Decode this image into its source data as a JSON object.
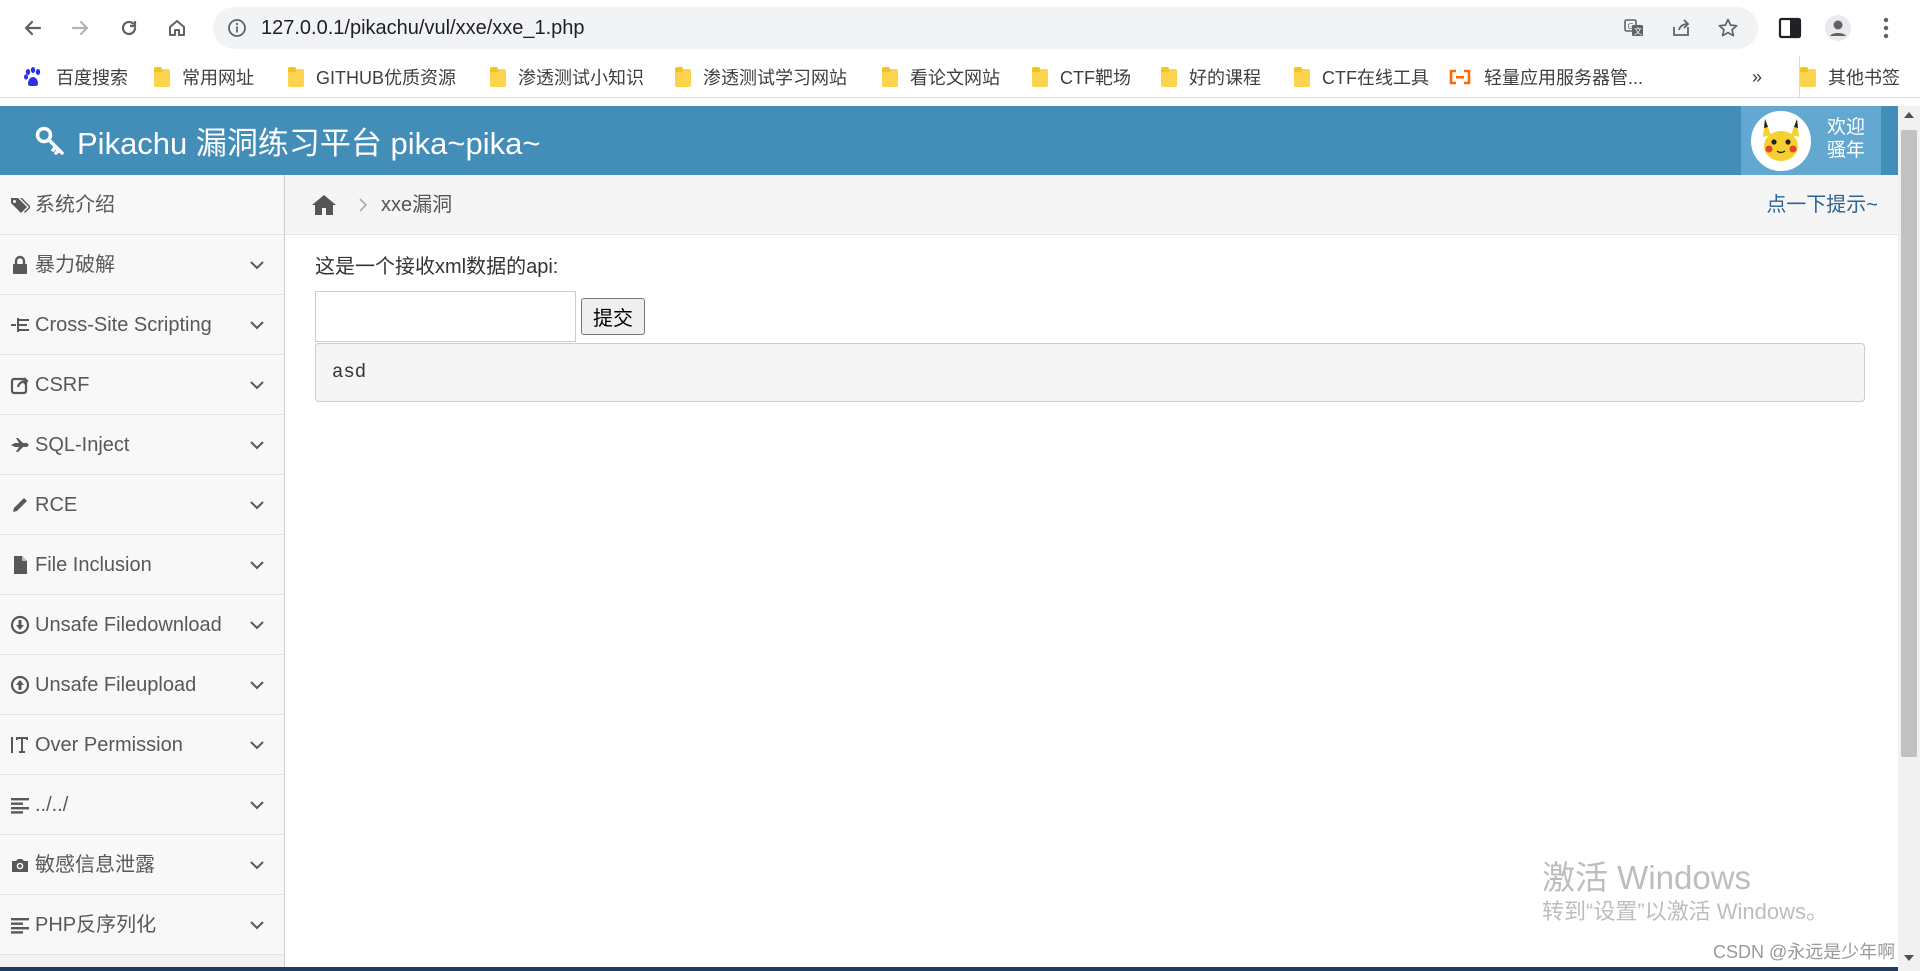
{
  "browser": {
    "url": "127.0.0.1/pikachu/vul/xxe/xxe_1.php",
    "bookmarks": [
      {
        "label": "百度搜索",
        "icon": "baidu-paw-icon"
      },
      {
        "label": "常用网址",
        "icon": "folder-icon"
      },
      {
        "label": "GITHUB优质资源",
        "icon": "folder-icon"
      },
      {
        "label": "渗透测试小知识",
        "icon": "folder-icon"
      },
      {
        "label": "渗透测试学习网站",
        "icon": "folder-icon"
      },
      {
        "label": "看论文网站",
        "icon": "folder-icon"
      },
      {
        "label": "CTF靶场",
        "icon": "folder-icon"
      },
      {
        "label": "好的课程",
        "icon": "folder-icon"
      },
      {
        "label": "CTF在线工具",
        "icon": "folder-icon"
      },
      {
        "label": "轻量应用服务器管...",
        "icon": "aliyun-icon"
      }
    ],
    "overflow": "»",
    "other_bookmarks": "其他书签"
  },
  "header": {
    "title": "Pikachu 漏洞练习平台 pika~pika~",
    "welcome_line1": "欢迎",
    "welcome_line2": "骚年",
    "color": "#438eb9"
  },
  "sidebar": {
    "items": [
      {
        "label": "系统介绍",
        "icon": "tags-icon",
        "expandable": false
      },
      {
        "label": "暴力破解",
        "icon": "lock-icon",
        "expandable": true
      },
      {
        "label": "Cross-Site Scripting",
        "icon": "indent-icon",
        "expandable": true
      },
      {
        "label": "CSRF",
        "icon": "share-icon",
        "expandable": true
      },
      {
        "label": "SQL-Inject",
        "icon": "fighter-jet-icon",
        "expandable": true
      },
      {
        "label": "RCE",
        "icon": "pencil-icon",
        "expandable": true
      },
      {
        "label": "File Inclusion",
        "icon": "file-icon",
        "expandable": true
      },
      {
        "label": "Unsafe Filedownload",
        "icon": "download-circle-icon",
        "expandable": true
      },
      {
        "label": "Unsafe Fileupload",
        "icon": "upload-circle-icon",
        "expandable": true
      },
      {
        "label": "Over Permission",
        "icon": "text-height-icon",
        "expandable": true
      },
      {
        "label": "../../",
        "icon": "align-left-icon",
        "expandable": true
      },
      {
        "label": "敏感信息泄露",
        "icon": "camera-icon",
        "expandable": true
      },
      {
        "label": "PHP反序列化",
        "icon": "align-left-icon",
        "expandable": true
      }
    ]
  },
  "breadcrumb": {
    "current": "xxe漏洞",
    "hint": "点一下提示~"
  },
  "main": {
    "api_text": "这是一个接收xml数据的api:",
    "input_value": "",
    "submit_label": "提交",
    "result": "asd"
  },
  "watermark": {
    "title": "激活 Windows",
    "subtitle": "转到“设置”以激活 Windows。",
    "csdn": "CSDN @永远是少年啊"
  }
}
